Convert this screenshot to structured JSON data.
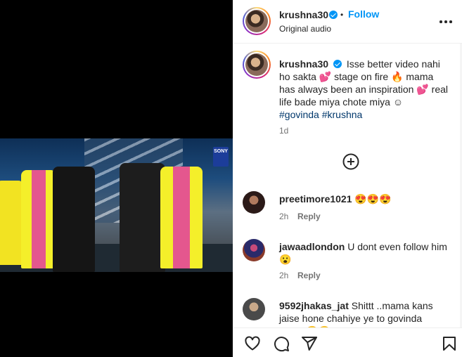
{
  "post": {
    "author": "krushna30",
    "follow_label": "Follow",
    "separator": "•",
    "audio": "Original audio",
    "caption_text": "Isse better video nahi ho sakta 💕 stage on fire 🔥 mama has always been an inspiration 💕 real life bade miya chote miya ☺",
    "hashtags": "#govinda #krushna",
    "time": "1d",
    "video_logo": "SONY"
  },
  "comments": [
    {
      "user": "preetimore1021",
      "text": "😍😍😍",
      "time": "2h",
      "reply": "Reply"
    },
    {
      "user": "jawaadlondon",
      "text": "U dont even follow him 😮",
      "time": "2h",
      "reply": "Reply"
    },
    {
      "user": "9592jhakas_jat",
      "text": "Shittt ..mama kans jaise hone chahiye ye to govinda hain...😂😂"
    }
  ],
  "icons": {
    "more": "more-options-icon",
    "load_more": "plus-circle-icon",
    "like": "heart-icon",
    "comment": "comment-icon",
    "share": "share-icon",
    "save": "bookmark-icon"
  }
}
